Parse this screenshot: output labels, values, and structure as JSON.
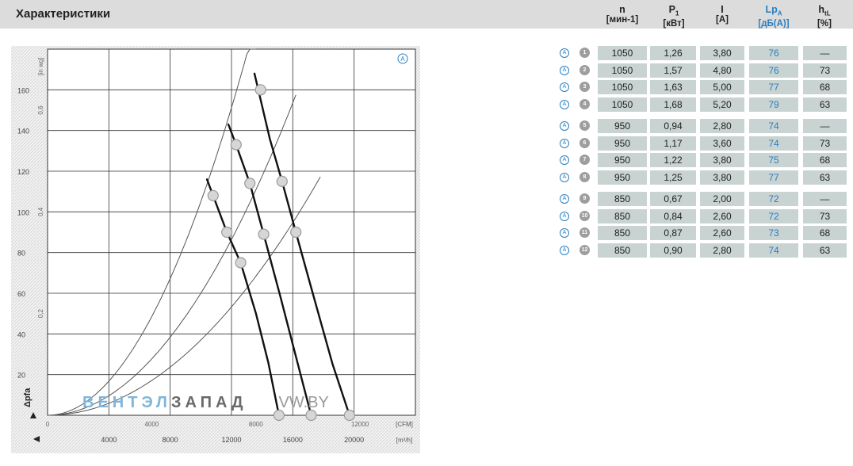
{
  "page": {
    "title": "Характеристики"
  },
  "columns": [
    {
      "symbol": "n",
      "sub": "",
      "unit": "[мин-1]",
      "accent": false
    },
    {
      "symbol": "P",
      "sub": "1",
      "unit": "[кВт]",
      "accent": false
    },
    {
      "symbol": "I",
      "sub": "",
      "unit": "[A]",
      "accent": false
    },
    {
      "symbol": "Lp",
      "sub": "A",
      "unit": "[дБ(A)]",
      "accent": true
    },
    {
      "symbol": "h",
      "sub": "tL",
      "unit": "[%]",
      "accent": false
    }
  ],
  "table_rows": [
    {
      "num": "1",
      "n": "1050",
      "p1": "1,26",
      "i": "3,80",
      "lpa": "76",
      "h": "—"
    },
    {
      "num": "2",
      "n": "1050",
      "p1": "1,57",
      "i": "4,80",
      "lpa": "76",
      "h": "73"
    },
    {
      "num": "3",
      "n": "1050",
      "p1": "1,63",
      "i": "5,00",
      "lpa": "77",
      "h": "68"
    },
    {
      "num": "4",
      "n": "1050",
      "p1": "1,68",
      "i": "5,20",
      "lpa": "79",
      "h": "63"
    },
    {
      "num": "5",
      "n": "950",
      "p1": "0,94",
      "i": "2,80",
      "lpa": "74",
      "h": "—"
    },
    {
      "num": "6",
      "n": "950",
      "p1": "1,17",
      "i": "3,60",
      "lpa": "74",
      "h": "73"
    },
    {
      "num": "7",
      "n": "950",
      "p1": "1,22",
      "i": "3,80",
      "lpa": "75",
      "h": "68"
    },
    {
      "num": "8",
      "n": "950",
      "p1": "1,25",
      "i": "3,80",
      "lpa": "77",
      "h": "63"
    },
    {
      "num": "9",
      "n": "850",
      "p1": "0,67",
      "i": "2,00",
      "lpa": "72",
      "h": "—"
    },
    {
      "num": "10",
      "n": "850",
      "p1": "0,84",
      "i": "2,60",
      "lpa": "72",
      "h": "73"
    },
    {
      "num": "11",
      "n": "850",
      "p1": "0,87",
      "i": "2,60",
      "lpa": "73",
      "h": "68"
    },
    {
      "num": "12",
      "n": "850",
      "p1": "0,90",
      "i": "2,80",
      "lpa": "74",
      "h": "63"
    }
  ],
  "badge_letter": "A",
  "watermark": {
    "part1": "ВЕНТЭЛ",
    "part2": "ЗАПАД",
    "part3": "VW.BY"
  },
  "chart_data": {
    "type": "line",
    "curve_badge": "A",
    "x_unit": "[m³/h]",
    "x_unit_alt": "[CFM]",
    "x_ticks": [
      "4000",
      "8000",
      "12000",
      "16000",
      "20000"
    ],
    "x_alt_ticks": [
      "0",
      "4000",
      "8000",
      "12000"
    ],
    "y_ticks": [
      "20",
      "40",
      "60",
      "80",
      "100",
      "120",
      "140",
      "160"
    ],
    "y_alt_ticks": [
      "0,2",
      "0,4",
      "0,6"
    ],
    "y_alt_unit": "[in wg]",
    "y_label": "Δpfa",
    "xlim": [
      0,
      24000
    ],
    "ylim": [
      0,
      180
    ],
    "grid": true,
    "fan_curves": [
      {
        "name": "1050",
        "points": [
          [
            13500,
            168
          ],
          [
            14500,
            136
          ],
          [
            15300,
            115
          ],
          [
            16200,
            90
          ],
          [
            17300,
            60
          ],
          [
            18600,
            25
          ],
          [
            19700,
            0
          ]
        ]
      },
      {
        "name": "950",
        "points": [
          [
            11800,
            143
          ],
          [
            12300,
            133
          ],
          [
            13200,
            114
          ],
          [
            14100,
            89
          ],
          [
            15200,
            58
          ],
          [
            16200,
            29
          ],
          [
            17200,
            0
          ]
        ]
      },
      {
        "name": "850",
        "points": [
          [
            10400,
            116
          ],
          [
            10800,
            108
          ],
          [
            11700,
            90
          ],
          [
            12600,
            75
          ],
          [
            13600,
            50
          ],
          [
            14400,
            26
          ],
          [
            15100,
            0
          ]
        ]
      }
    ],
    "system_curves": [
      {
        "name": "sys1",
        "k": 1.05e-06,
        "xmax": 13700
      },
      {
        "name": "sys2",
        "k": 6e-07,
        "xmax": 16200
      },
      {
        "name": "sys3",
        "k": 3.7e-07,
        "xmax": 17800
      }
    ],
    "operating_points": [
      {
        "label": "1",
        "x": 19700,
        "y": 0
      },
      {
        "label": "2",
        "x": 16200,
        "y": 90
      },
      {
        "label": "3",
        "x": 15300,
        "y": 115
      },
      {
        "label": "4",
        "x": 13900,
        "y": 160
      },
      {
        "label": "5",
        "x": 17200,
        "y": 0
      },
      {
        "label": "6",
        "x": 14100,
        "y": 89
      },
      {
        "label": "7",
        "x": 13200,
        "y": 114
      },
      {
        "label": "8",
        "x": 12300,
        "y": 133
      },
      {
        "label": "9",
        "x": 15100,
        "y": 0
      },
      {
        "label": "10",
        "x": 12600,
        "y": 75
      },
      {
        "label": "11",
        "x": 11700,
        "y": 90
      },
      {
        "label": "12",
        "x": 10800,
        "y": 108
      }
    ]
  }
}
